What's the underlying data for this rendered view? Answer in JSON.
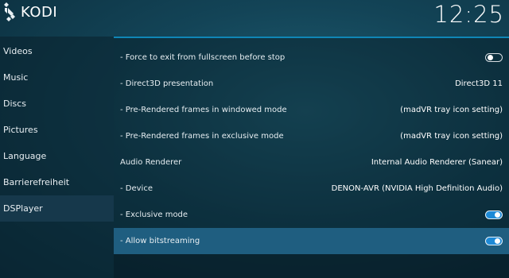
{
  "header": {
    "app_name": "KODI",
    "clock": "12:25"
  },
  "sidebar": {
    "items": [
      {
        "label": "Videos"
      },
      {
        "label": "Music"
      },
      {
        "label": "Discs"
      },
      {
        "label": "Pictures"
      },
      {
        "label": "Language"
      },
      {
        "label": "Barrierefreiheit"
      },
      {
        "label": "DSPlayer"
      }
    ],
    "active": "DSPlayer"
  },
  "settings": {
    "rows": [
      {
        "label": "- Force to exit from fullscreen before stop",
        "toggle": "off"
      },
      {
        "label": "- Direct3D presentation",
        "value": "Direct3D 11"
      },
      {
        "label": "- Pre-Rendered frames in windowed mode",
        "value": "(madVR tray icon setting)"
      },
      {
        "label": "- Pre-Rendered frames in exclusive mode",
        "value": "(madVR tray icon setting)"
      },
      {
        "label": "Audio Renderer",
        "value": "Internal Audio Renderer (Sanear)"
      },
      {
        "label": "- Device",
        "value": "DENON-AVR (NVIDIA High Definition Audio)"
      },
      {
        "label": "- Exclusive mode",
        "toggle": "on"
      },
      {
        "label": "- Allow bitstreaming",
        "toggle": "on"
      }
    ],
    "focused_row": "- Allow bitstreaming"
  },
  "colors": {
    "accent": "#1e8ad6",
    "focus_row": "#1f5e80",
    "separator": "#0f86b6"
  }
}
